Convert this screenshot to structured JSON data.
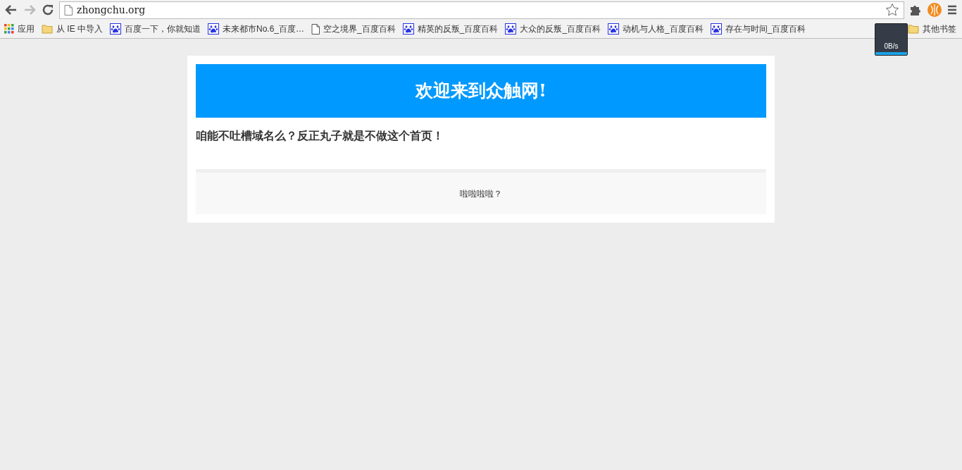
{
  "browser": {
    "url": "zhongchu.org",
    "back_disabled": false,
    "forward_disabled": true
  },
  "bookmarks": [
    {
      "kind": "apps",
      "label": "应用"
    },
    {
      "kind": "folder",
      "label": "从 IE 中导入"
    },
    {
      "kind": "baidu",
      "label": "百度一下，你就知道"
    },
    {
      "kind": "baidu",
      "label": "未来都市No.6_百度…"
    },
    {
      "kind": "page",
      "label": "空之境界_百度百科"
    },
    {
      "kind": "baidu",
      "label": "精英的反叛_百度百科"
    },
    {
      "kind": "baidu",
      "label": "大众的反叛_百度百科"
    },
    {
      "kind": "baidu",
      "label": "动机与人格_百度百科"
    },
    {
      "kind": "baidu",
      "label": "存在与时间_百度百科"
    }
  ],
  "other_bookmarks": {
    "kind": "folder",
    "label": "其他书签"
  },
  "speed_popup": {
    "text": "0B/s"
  },
  "page": {
    "banner": "欢迎来到众触网!",
    "subtitle": "咱能不吐槽域名么？反正丸子就是不做这个首页！",
    "footer": "啦啦啦啦？"
  }
}
